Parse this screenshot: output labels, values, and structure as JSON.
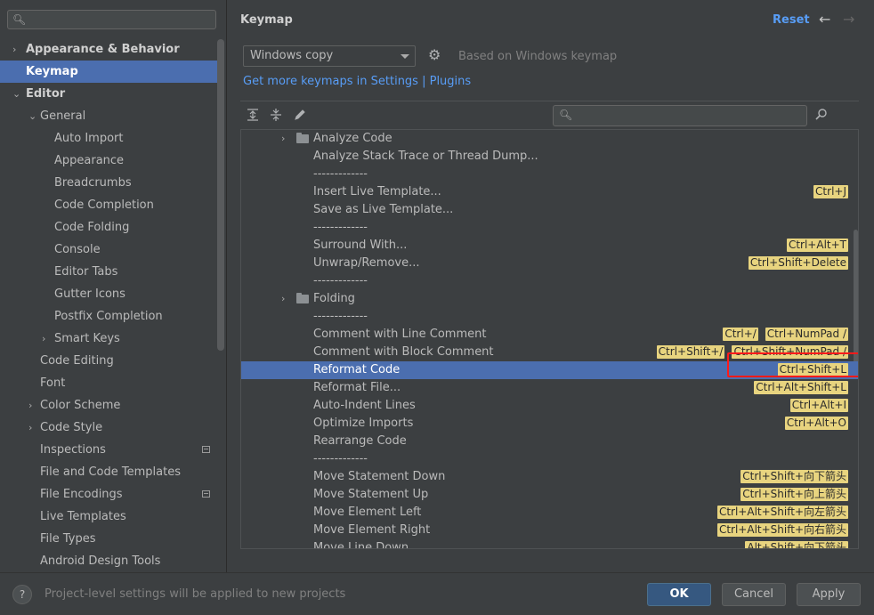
{
  "sidebar": {
    "search": {
      "placeholder": ""
    },
    "items": [
      {
        "label": "Appearance & Behavior",
        "level": 0,
        "chevron": "›",
        "bold": true
      },
      {
        "label": "Keymap",
        "level": 0,
        "chevron": "",
        "bold": true,
        "selected": true
      },
      {
        "label": "Editor",
        "level": 0,
        "chevron": "⌄",
        "bold": true
      },
      {
        "label": "General",
        "level": 1,
        "chevron": "⌄"
      },
      {
        "label": "Auto Import",
        "level": 2,
        "chevron": ""
      },
      {
        "label": "Appearance",
        "level": 2,
        "chevron": ""
      },
      {
        "label": "Breadcrumbs",
        "level": 2,
        "chevron": ""
      },
      {
        "label": "Code Completion",
        "level": 2,
        "chevron": ""
      },
      {
        "label": "Code Folding",
        "level": 2,
        "chevron": ""
      },
      {
        "label": "Console",
        "level": 2,
        "chevron": ""
      },
      {
        "label": "Editor Tabs",
        "level": 2,
        "chevron": ""
      },
      {
        "label": "Gutter Icons",
        "level": 2,
        "chevron": ""
      },
      {
        "label": "Postfix Completion",
        "level": 2,
        "chevron": ""
      },
      {
        "label": "Smart Keys",
        "level": 2,
        "chevron": "›"
      },
      {
        "label": "Code Editing",
        "level": 1,
        "chevron": ""
      },
      {
        "label": "Font",
        "level": 1,
        "chevron": ""
      },
      {
        "label": "Color Scheme",
        "level": 1,
        "chevron": "›"
      },
      {
        "label": "Code Style",
        "level": 1,
        "chevron": "›"
      },
      {
        "label": "Inspections",
        "level": 1,
        "chevron": "",
        "project_icon": true
      },
      {
        "label": "File and Code Templates",
        "level": 1,
        "chevron": ""
      },
      {
        "label": "File Encodings",
        "level": 1,
        "chevron": "",
        "project_icon": true
      },
      {
        "label": "Live Templates",
        "level": 1,
        "chevron": ""
      },
      {
        "label": "File Types",
        "level": 1,
        "chevron": ""
      },
      {
        "label": "Android Design Tools",
        "level": 1,
        "chevron": ""
      }
    ]
  },
  "header": {
    "title": "Keymap",
    "reset": "Reset",
    "back_icon": "←",
    "forward_icon": "→"
  },
  "keymap": {
    "selected": "Windows copy",
    "based_on": "Based on Windows keymap",
    "links": "Get more keymaps in Settings | Plugins",
    "search_placeholder": ""
  },
  "toolbar": {
    "expand_icon": "expand-all-icon",
    "collapse_icon": "collapse-all-icon",
    "edit_icon": "edit-icon"
  },
  "actions": [
    {
      "name": "Analyze Code",
      "folder": true,
      "shortcuts": []
    },
    {
      "name": "Analyze Stack Trace or Thread Dump...",
      "shortcuts": []
    },
    {
      "name": "-------------",
      "shortcuts": []
    },
    {
      "name": "Insert Live Template...",
      "shortcuts": [
        "Ctrl+J"
      ]
    },
    {
      "name": "Save as Live Template...",
      "shortcuts": []
    },
    {
      "name": "-------------",
      "shortcuts": []
    },
    {
      "name": "Surround With...",
      "shortcuts": [
        "Ctrl+Alt+T"
      ]
    },
    {
      "name": "Unwrap/Remove...",
      "shortcuts": [
        "Ctrl+Shift+Delete"
      ]
    },
    {
      "name": "-------------",
      "shortcuts": []
    },
    {
      "name": "Folding",
      "folder": true,
      "shortcuts": []
    },
    {
      "name": "-------------",
      "shortcuts": []
    },
    {
      "name": "Comment with Line Comment",
      "shortcuts": [
        "Ctrl+/",
        "Ctrl+NumPad /"
      ]
    },
    {
      "name": "Comment with Block Comment",
      "shortcuts": [
        "Ctrl+Shift+/",
        "Ctrl+Shift+NumPad /"
      ]
    },
    {
      "name": "Reformat Code",
      "selected": true,
      "shortcuts": [
        "Ctrl+Shift+L"
      ]
    },
    {
      "name": "Reformat File...",
      "shortcuts": [
        "Ctrl+Alt+Shift+L"
      ]
    },
    {
      "name": "Auto-Indent Lines",
      "shortcuts": [
        "Ctrl+Alt+I"
      ]
    },
    {
      "name": "Optimize Imports",
      "shortcuts": [
        "Ctrl+Alt+O"
      ]
    },
    {
      "name": "Rearrange Code",
      "shortcuts": []
    },
    {
      "name": "-------------",
      "shortcuts": []
    },
    {
      "name": "Move Statement Down",
      "shortcuts": [
        "Ctrl+Shift+向下箭头"
      ]
    },
    {
      "name": "Move Statement Up",
      "shortcuts": [
        "Ctrl+Shift+向上箭头"
      ]
    },
    {
      "name": "Move Element Left",
      "shortcuts": [
        "Ctrl+Alt+Shift+向左箭头"
      ]
    },
    {
      "name": "Move Element Right",
      "shortcuts": [
        "Ctrl+Alt+Shift+向右箭头"
      ]
    },
    {
      "name": "Move Line Down",
      "shortcuts": [
        "Alt+Shift+向下箭头"
      ]
    }
  ],
  "footer": {
    "help": "?",
    "hint": "Project-level settings will be applied to new projects",
    "ok": "OK",
    "cancel": "Cancel",
    "apply": "Apply"
  },
  "colors": {
    "background": "#3c3f41",
    "selection": "#4b6eaf",
    "link": "#589df6",
    "shortcut_badge": "#e8d47f",
    "highlight_box": "#ff1a1a"
  }
}
